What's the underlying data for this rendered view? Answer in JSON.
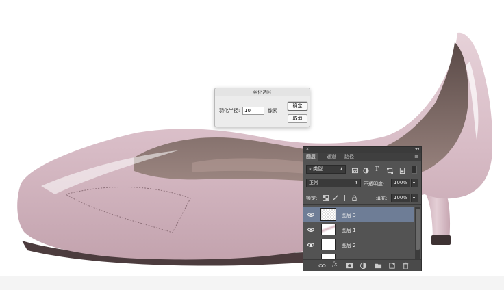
{
  "feather_dialog": {
    "title": "羽化选区",
    "radius_label": "羽化半径:",
    "radius_value": "10",
    "unit": "像素",
    "ok_label": "确定",
    "cancel_label": "取消"
  },
  "layers_panel": {
    "tabs": [
      {
        "label": "图层",
        "active": true
      },
      {
        "label": "通道",
        "active": false
      },
      {
        "label": "路径",
        "active": false
      }
    ],
    "filter_kind": "类型",
    "blend_mode": "正常",
    "opacity_label": "不透明度:",
    "opacity_value": "100%",
    "lock_label": "锁定:",
    "fill_label": "填充:",
    "fill_value": "100%",
    "layers": [
      {
        "name": "图层 3",
        "selected": true,
        "visible": true
      },
      {
        "name": "图层 1",
        "selected": false,
        "visible": true
      },
      {
        "name": "图层 2",
        "selected": false,
        "visible": true
      }
    ],
    "footer_icons": [
      "link-icon",
      "fx-icon",
      "mask-icon",
      "adjustment-icon",
      "folder-icon",
      "new-layer-icon",
      "trash-icon"
    ]
  },
  "colors": {
    "shoe_pink": "#dcc2cb",
    "shoe_interior": "#7a6662",
    "panel_bg": "#535353",
    "selected_layer": "#6e7d96"
  }
}
